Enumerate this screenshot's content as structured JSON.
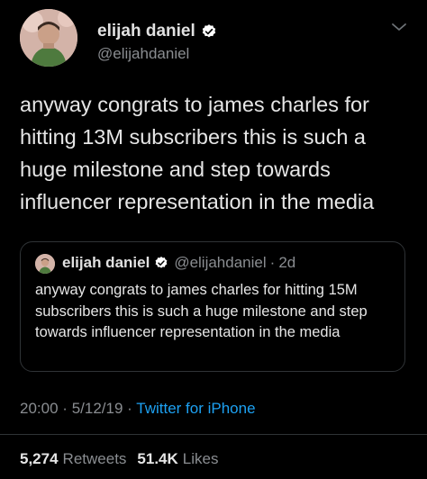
{
  "author": {
    "name": "elijah daniel",
    "handle": "@elijahdaniel"
  },
  "tweet": {
    "text": "anyway congrats to james charles for hitting 13M subscribers this is such a huge milestone and step towards influencer representation in the media",
    "time": "20:00",
    "date": "5/12/19",
    "separator": "·",
    "source": "Twitter for iPhone"
  },
  "quoted": {
    "name": "elijah daniel",
    "handle": "@elijahdaniel",
    "age": "2d",
    "text": "anyway congrats to james charles for hitting 15M subscribers this is such a huge milestone and step towards influencer representation in the media"
  },
  "stats": {
    "retweets_count": "5,274",
    "retweets_label": "Retweets",
    "likes_count": "51.4K",
    "likes_label": "Likes"
  },
  "icons": {
    "verified": "verified-badge-icon",
    "menu": "chevron-down-icon"
  },
  "colors": {
    "background": "#000000",
    "link": "#1da1f2",
    "secondary_text": "#8a8d91"
  }
}
